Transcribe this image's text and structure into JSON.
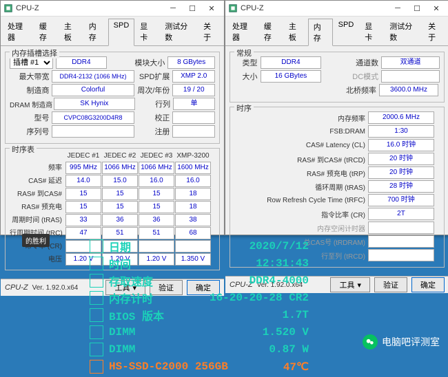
{
  "win1": {
    "title": "CPU-Z",
    "tabs": [
      "处理器",
      "缓存",
      "主板",
      "内存",
      "SPD",
      "显卡",
      "测试分数",
      "关于"
    ],
    "activeTab": 4,
    "slotGroup": "内存插槽选择",
    "slotLabel": "插槽 #1",
    "fields": {
      "type": "DDR4",
      "modsize_lbl": "模块大小",
      "modsize": "8 GBytes",
      "maxbw_lbl": "最大带宽",
      "maxbw": "DDR4-2132 (1066 MHz)",
      "spdext_lbl": "SPD扩展",
      "spdext": "XMP 2.0",
      "mfr_lbl": "制造商",
      "mfr": "Colorful",
      "week_lbl": "周次/年份",
      "week": "19 / 20",
      "dram_lbl": "DRAM 制造商",
      "dram": "SK Hynix",
      "ranks_lbl": "行列",
      "ranks": "单",
      "pn_lbl": "型号",
      "pn": "CVPC08G3200D4R8",
      "correct_lbl": "校正",
      "sn_lbl": "序列号",
      "reg_lbl": "注册"
    },
    "timingGroup": "时序表",
    "timingCols": [
      "JEDEC #1",
      "JEDEC #2",
      "JEDEC #3",
      "XMP-3200"
    ],
    "timingRows": [
      {
        "lbl": "频率",
        "v": [
          "995 MHz",
          "1066 MHz",
          "1066 MHz",
          "1600 MHz"
        ]
      },
      {
        "lbl": "CAS# 延迟",
        "v": [
          "14.0",
          "15.0",
          "16.0",
          "16.0"
        ]
      },
      {
        "lbl": "RAS# 到CAS#",
        "v": [
          "15",
          "15",
          "15",
          "18"
        ]
      },
      {
        "lbl": "RAS# 预充电",
        "v": [
          "15",
          "15",
          "15",
          "18"
        ]
      },
      {
        "lbl": "周期时间 (tRAS)",
        "v": [
          "33",
          "36",
          "36",
          "38"
        ]
      },
      {
        "lbl": "行周期时间 (tRC)",
        "v": [
          "47",
          "51",
          "51",
          "68"
        ]
      },
      {
        "lbl": "命令率 (CR)",
        "v": [
          "",
          "",
          "",
          ""
        ]
      },
      {
        "lbl": "电压",
        "v": [
          "1.20 V",
          "1.20 V",
          "1.20 V",
          "1.350 V"
        ]
      }
    ]
  },
  "win2": {
    "title": "CPU-Z",
    "tabs": [
      "处理器",
      "缓存",
      "主板",
      "内存",
      "SPD",
      "显卡",
      "测试分数",
      "关于"
    ],
    "activeTab": 3,
    "genGroup": "常规",
    "gen": {
      "type_lbl": "类型",
      "type": "DDR4",
      "chan_lbl": "通道数",
      "chan": "双通道",
      "size_lbl": "大小",
      "size": "16 GBytes",
      "dc_lbl": "DC模式",
      "nb_lbl": "北桥频率",
      "nb": "3600.0 MHz"
    },
    "timGroup": "时序",
    "tim": [
      {
        "lbl": "内存频率",
        "v": "2000.6 MHz"
      },
      {
        "lbl": "FSB:DRAM",
        "v": "1:30"
      },
      {
        "lbl": "CAS# Latency (CL)",
        "v": "16.0 时钟"
      },
      {
        "lbl": "RAS# 到CAS# (tRCD)",
        "v": "20 时钟"
      },
      {
        "lbl": "RAS# 预充电 (tRP)",
        "v": "20 时钟"
      },
      {
        "lbl": "循环周期 (tRAS)",
        "v": "28 时钟"
      },
      {
        "lbl": "Row Refresh Cycle Time (tRFC)",
        "v": "700 时钟"
      },
      {
        "lbl": "指令比率 (CR)",
        "v": "2T"
      },
      {
        "lbl": "内存空闲计时器",
        "v": "",
        "dim": true
      },
      {
        "lbl": "总CAS号 (tRDRAM)",
        "v": "",
        "dim": true
      },
      {
        "lbl": "行至列 (tRCD)",
        "v": "",
        "dim": true
      }
    ]
  },
  "footer": {
    "brand": "CPU-Z",
    "ver": "Ver. 1.92.0.x64",
    "tools": "工具",
    "validate": "验证",
    "ok": "确定"
  },
  "badge": "的胜利",
  "osd": [
    {
      "k": "日期",
      "v": "2020/7/12",
      "c": "teal"
    },
    {
      "k": "时间",
      "v": "12:31:43",
      "c": "teal"
    },
    {
      "k": "存取速度",
      "v": "DDR4-4000",
      "c": "teal"
    },
    {
      "k": "内存计时",
      "v": "16-20-20-28 CR2",
      "c": "teal"
    },
    {
      "k": "BIOS 版本",
      "v": "1.7T",
      "c": "teal"
    },
    {
      "k": "DIMM",
      "v": "1.520 V",
      "c": "teal"
    },
    {
      "k": "DIMM",
      "v": "0.87 W",
      "c": "teal"
    },
    {
      "k": "HS-SSD-C2000 256GB",
      "v": "47℃",
      "c": "orange"
    }
  ],
  "watermark": "电脑吧评测室"
}
